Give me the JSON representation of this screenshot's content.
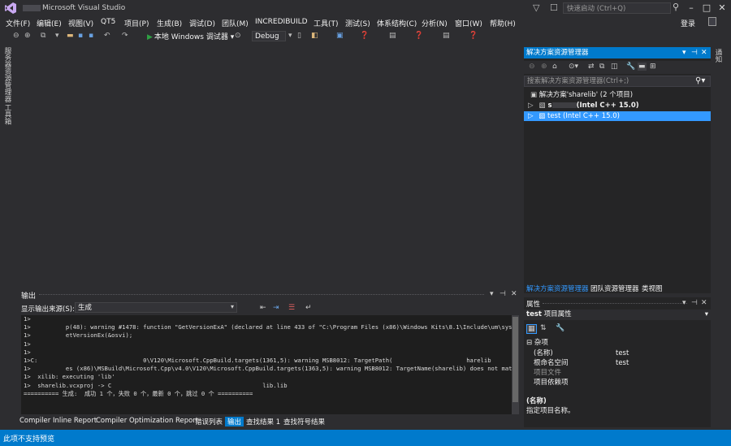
{
  "window": {
    "title": "Microsoft Visual Studio",
    "quick_launch_placeholder": "快速启动 (Ctrl+Q)",
    "login": "登录"
  },
  "menu": [
    "文件(F)",
    "编辑(E)",
    "视图(V)",
    "QT5",
    "项目(P)",
    "生成(B)",
    "调试(D)",
    "团队(M)",
    "INCREDIBUILD",
    "工具(T)",
    "测试(S)",
    "体系结构(C)",
    "分析(N)",
    "窗口(W)",
    "帮助(H)"
  ],
  "toolbar": {
    "run_label": "本地 Windows 调试器",
    "config": "Debug"
  },
  "left_tabs": [
    "服务器资源管理器",
    "工具箱"
  ],
  "output": {
    "title": "输出",
    "source_label": "显示输出来源(S):",
    "source_value": "生成",
    "lines": [
      "1>",
      "1>          p(48): warning #1478: function \"GetVersionExA\" (declared at line 433 of \"C:\\Program Files (x86)\\Windows Kits\\8.1\\Include\\um\\sysinfo",
      "1>          etVersionEx(&osvi);",
      "1>",
      "1>",
      "1>C:                              0\\V120\\Microsoft.CppBuild.targets(1361,5): warning MSB8012: TargetPath(                     harelib",
      "1>          es (x86)\\MSBuild\\Microsoft.Cpp\\v4.0\\V120\\Microsoft.CppBuild.targets(1363,5): warning MSB8012: TargetName(sharelib) does not match the L",
      "1>  xilib: executing 'lib'",
      "1>  sharelib.vcxproj -> C                                           lib.lib",
      "========== 生成:  成功 1 个，失败 0 个，最新 0 个，跳过 0 个 =========="
    ],
    "bottom_tabs": [
      "Compiler Inline Report",
      "Compiler Optimization Report",
      "错误列表",
      "输出",
      "查找结果 1",
      "查找符号结果"
    ],
    "active_tab": "输出"
  },
  "solution_explorer": {
    "title": "解决方案资源管理器",
    "search_placeholder": "搜索解决方案资源管理器(Ctrl+;)",
    "items": [
      {
        "label": "解决方案'sharelib' (2 个项目)"
      },
      {
        "label": "(Intel C++ 15.0)",
        "prefix": "s"
      },
      {
        "label": "test (Intel C++ 15.0)"
      }
    ],
    "tabs": [
      "解决方案资源管理器",
      "团队资源管理器",
      "类视图"
    ]
  },
  "properties": {
    "title": "属性",
    "object_name": "test",
    "object_type": "项目属性",
    "category": "杂项",
    "rows": [
      {
        "name": "(名称)",
        "value": "test"
      },
      {
        "name": "根命名空间",
        "value": "test"
      },
      {
        "name": "项目文件",
        "value": ""
      },
      {
        "name": "项目依赖项",
        "value": ""
      }
    ],
    "desc_name": "(名称)",
    "desc_text": "指定项目名称。"
  },
  "right_tab": "通知",
  "status": "此项不支持预览",
  "colors": {
    "accent": "#007acc",
    "background": "#2d2d30",
    "selection": "#3399ff"
  }
}
